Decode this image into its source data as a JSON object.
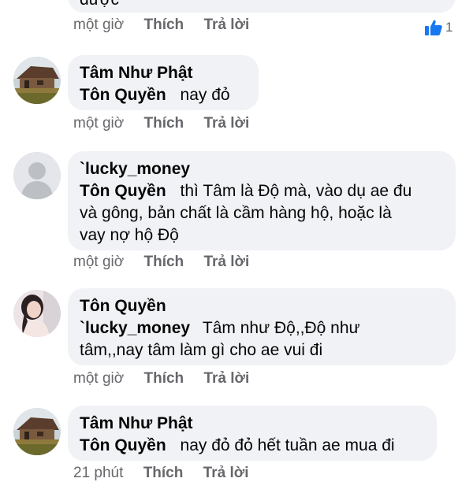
{
  "comments": [
    {
      "text_lines": [
        "được"
      ],
      "meta": {
        "time": "một giờ",
        "like": "Thích",
        "reply": "Trả lời"
      },
      "reaction_count": "1"
    },
    {
      "author": "Tâm Như Phật",
      "mention": "Tôn Quyền",
      "text_lines": [
        "nay đỏ"
      ],
      "meta": {
        "time": "một giờ",
        "like": "Thích",
        "reply": "Trả lời"
      }
    },
    {
      "author": "`lucky_money",
      "mention": "Tôn Quyền",
      "text_lines": [
        "thì Tâm là Độ mà, vào dụ ae đu",
        "và gông, bản chất là cầm hàng hộ, hoặc là",
        "vay nợ hộ Độ"
      ],
      "meta": {
        "time": "một giờ",
        "like": "Thích",
        "reply": "Trả lời"
      }
    },
    {
      "author": "Tôn Quyền",
      "mention": "`lucky_money",
      "text_lines": [
        "Tâm như Độ,,Độ như",
        "tâm,,nay tâm làm gì cho ae vui đi"
      ],
      "meta": {
        "time": "một giờ",
        "like": "Thích",
        "reply": "Trả lời"
      }
    },
    {
      "author": "Tâm Như Phật",
      "mention": "Tôn Quyền",
      "text_lines": [
        "nay đỏ đỏ hết tuần ae mua đi"
      ],
      "meta": {
        "time": "21 phút",
        "like": "Thích",
        "reply": "Trả lời"
      }
    }
  ],
  "colors": {
    "bubble": "#f0f2f5",
    "meta_text": "#65676b",
    "like_icon": "#1877f2"
  }
}
